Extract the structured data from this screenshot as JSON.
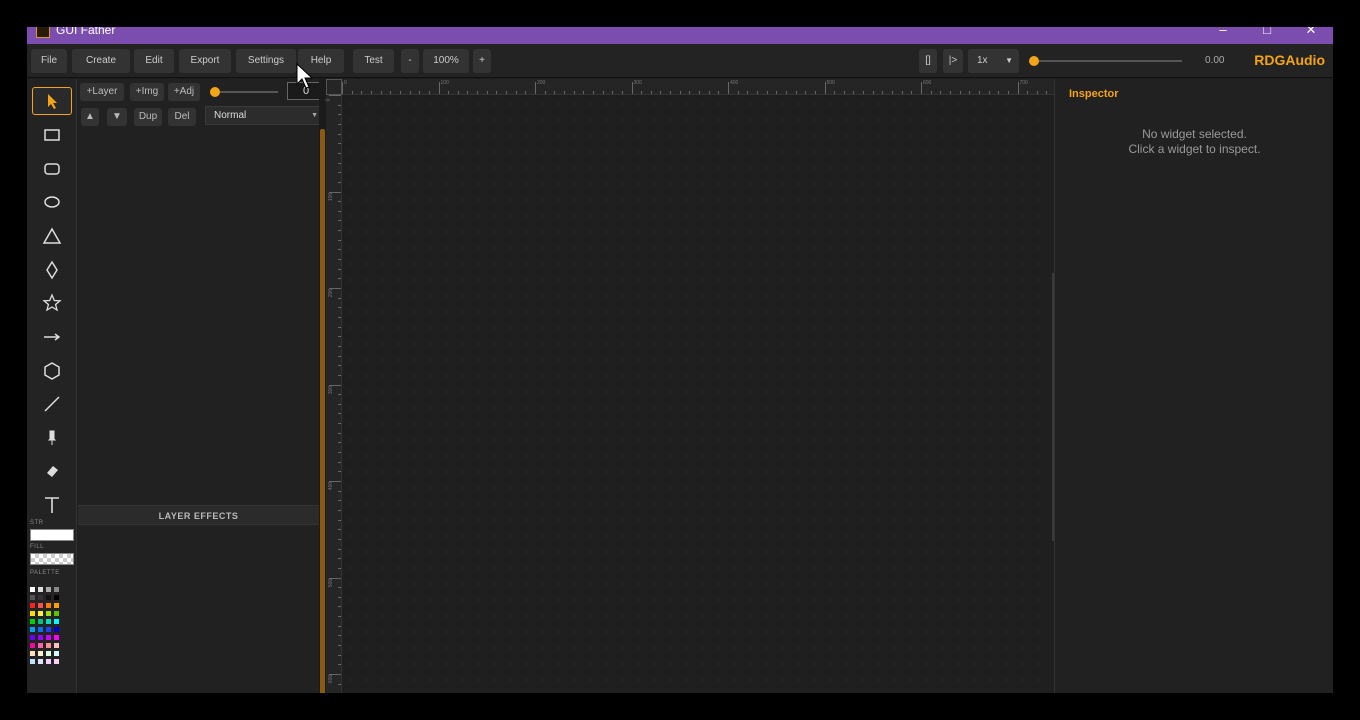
{
  "window": {
    "title": "GUI Father"
  },
  "menu": {
    "file": "File",
    "create": "Create",
    "edit": "Edit",
    "export": "Export",
    "settings": "Settings",
    "help": "Help",
    "test": "Test",
    "zoom_out": "-",
    "zoom": "100%",
    "zoom_in": "+"
  },
  "playback": {
    "bracket": "[]",
    "play": "|>",
    "speed": "1x",
    "time": "0.00",
    "time_fraction": 0.0
  },
  "brand": {
    "name": "RDGAudio",
    "accent": "#f4a417"
  },
  "layers": {
    "add_layer": "+Layer",
    "add_img": "+Img",
    "add_adj": "+Adj",
    "opacity_value": "0",
    "up": "▲",
    "down": "▼",
    "dup": "Dup",
    "del": "Del",
    "blend_mode": "Normal",
    "effects_header": "LAYER EFFECTS"
  },
  "tools": {
    "items": [
      "select-tool",
      "rectangle-tool",
      "rounded-rect-tool",
      "ellipse-tool",
      "triangle-tool",
      "diamond-tool",
      "star-tool",
      "arrow-tool",
      "hexagon-tool",
      "line-tool",
      "pen-tool",
      "eraser-tool",
      "text-tool"
    ],
    "stroke_label": "STR",
    "fill_label": "FILL",
    "palette_label": "PALETTE",
    "palette": [
      [
        "#ffffff",
        "#dddddd",
        "#aaaaaa",
        "#888888"
      ],
      [
        "#555555",
        "#333333",
        "#111111",
        "#000000"
      ],
      [
        "#ff2020",
        "#ff5050",
        "#ff7a00",
        "#ffa000"
      ],
      [
        "#ffdd00",
        "#ffee44",
        "#a0e000",
        "#60c000"
      ],
      [
        "#00d000",
        "#00c080",
        "#00e0c0",
        "#00ffff"
      ],
      [
        "#00a0ff",
        "#0070ff",
        "#2040ff",
        "#0000cc"
      ],
      [
        "#6a00ff",
        "#9a00ff",
        "#cc00ff",
        "#ff00ff"
      ],
      [
        "#ff00a0",
        "#ff60b0",
        "#ff9090",
        "#ffc0c0"
      ],
      [
        "#ffe0c0",
        "#fff0d0",
        "#e0ffe0",
        "#d0ffff"
      ],
      [
        "#c0e0ff",
        "#e0e0ff",
        "#f0d0ff",
        "#ffd0f0"
      ]
    ]
  },
  "ruler": {
    "h": [
      "0",
      "100",
      "200",
      "300",
      "400",
      "500",
      "600",
      "700"
    ],
    "v": [
      "0",
      "100",
      "200",
      "300",
      "400",
      "500",
      "600"
    ]
  },
  "inspector": {
    "title": "Inspector",
    "msg1": "No widget selected.",
    "msg2": "Click a widget to inspect."
  }
}
